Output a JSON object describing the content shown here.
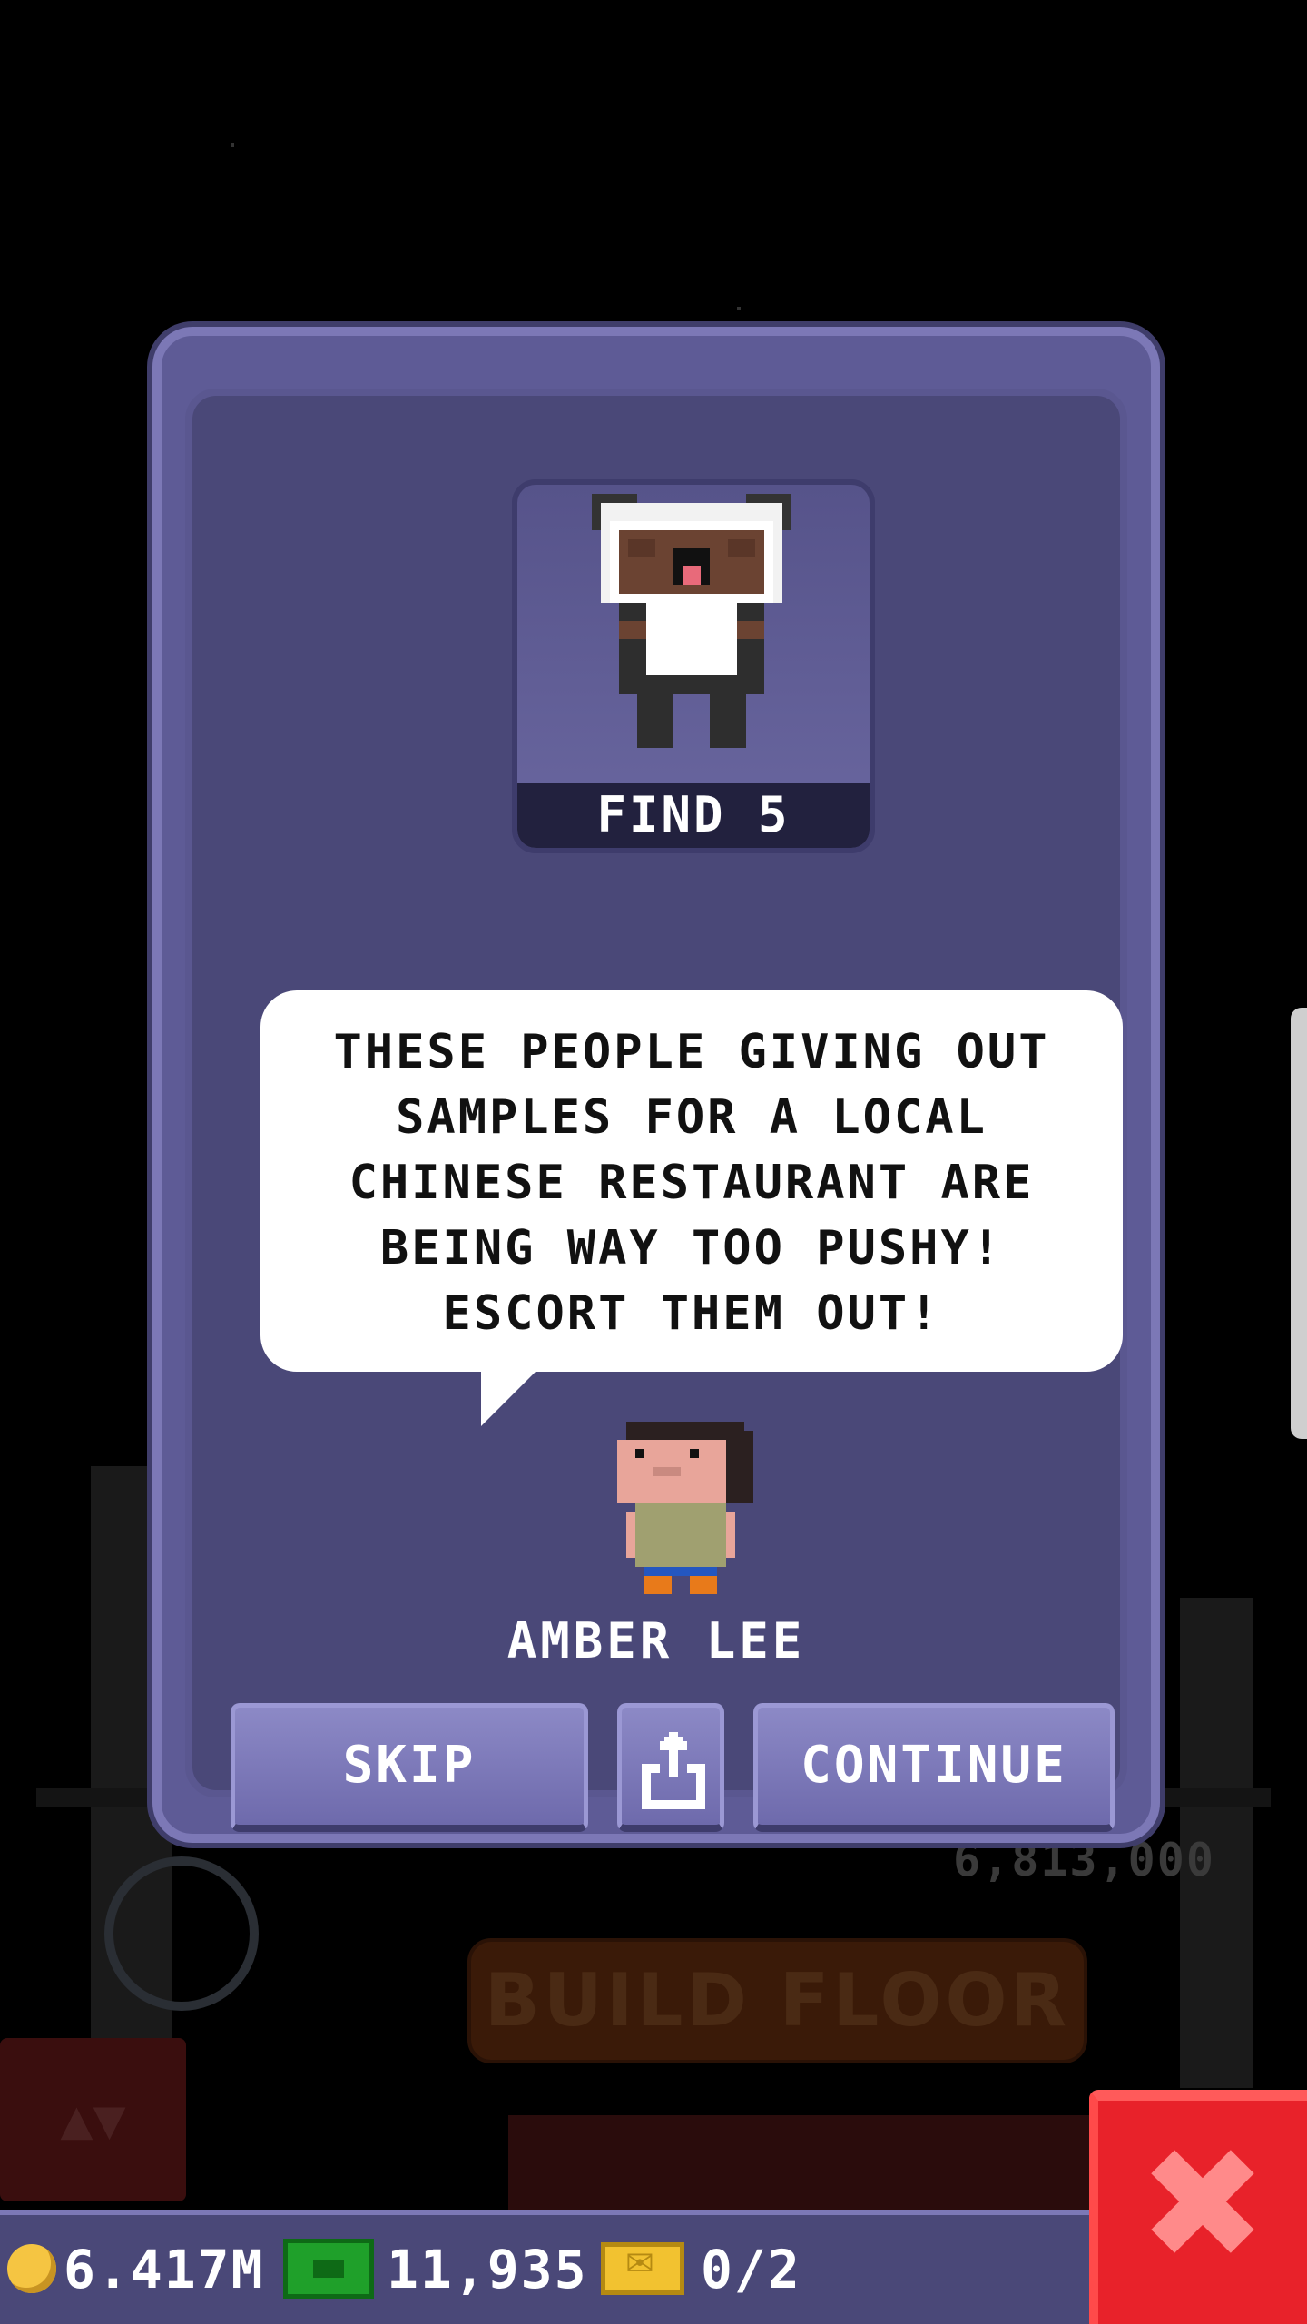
{
  "background": {
    "floor_price": "6,813,000",
    "build_floor_label": "BUILD FLOOR",
    "elevator_arrows": "▲▼"
  },
  "dialog": {
    "target_label": "FIND 5",
    "speech_text": "THESE PEOPLE GIVING OUT\nSAMPLES FOR A LOCAL\nCHINESE RESTAURANT ARE\nBEING WAY TOO PUSHY!\nESCORT THEM OUT!",
    "npc_name": "AMBER LEE",
    "skip_label": "SKIP",
    "continue_label": "CONTINUE",
    "share_icon": "share-icon"
  },
  "statusbar": {
    "coins": "6.417M",
    "bux": "11,935",
    "tickets": "0/2"
  },
  "close_label": "✖",
  "colors": {
    "dialog_bg": "#5e5b96",
    "dialog_border": "#7c78b6",
    "close_red": "#e8222a",
    "coin_gold": "#f5c542",
    "bux_green": "#1fa02a"
  }
}
